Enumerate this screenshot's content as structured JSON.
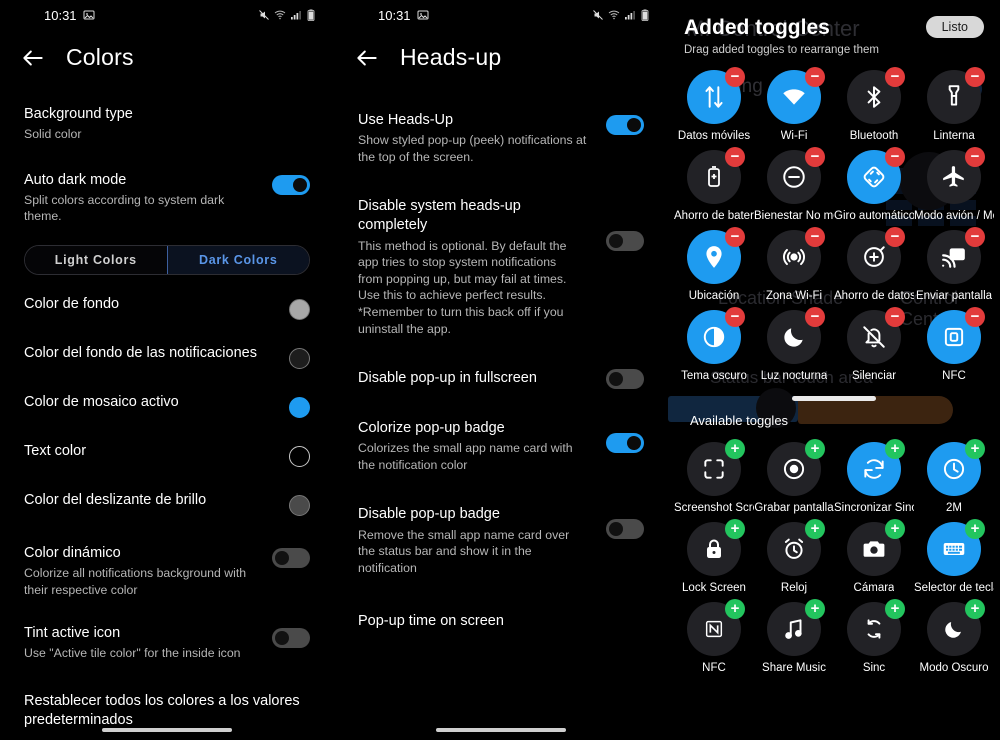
{
  "status_bar": {
    "time": "10:31",
    "left_icons": [
      "image-icon"
    ],
    "right_icons": [
      "mute-icon",
      "wifi-icon",
      "signal-icon",
      "battery-icon"
    ]
  },
  "panel_colors": {
    "title": "Colors",
    "back_icon": "back-arrow-icon",
    "rows": [
      {
        "title": "Background type",
        "sub": "Solid color",
        "control": "none"
      },
      {
        "title": "Auto dark mode",
        "sub": "Split colors according to system dark theme.",
        "control": "toggle",
        "state": "on"
      }
    ],
    "segmented": {
      "options": [
        "Light Colors",
        "Dark Colors"
      ],
      "selected": "Dark Colors"
    },
    "color_rows": [
      {
        "title": "Color de fondo",
        "swatch": "#a8a8a8"
      },
      {
        "title": "Color del fondo de las notificaciones",
        "swatch": "#1d1d1d"
      },
      {
        "title": "Color de mosaico activo",
        "swatch": "#1e9bf0"
      },
      {
        "title": "Text color",
        "swatch": "#000000"
      },
      {
        "title": "Color del deslizante de brillo",
        "swatch": "#4a4a4a"
      }
    ],
    "bottom_rows": [
      {
        "title": "Color dinámico",
        "sub": "Colorize all notifications background with their respective color",
        "control": "toggle",
        "state": "off"
      },
      {
        "title": "Tint active icon",
        "sub": "Use \"Active tile color\" for the inside icon",
        "control": "toggle",
        "state": "off"
      }
    ],
    "reset_label": "Restablecer todos los colores a los valores predeterminados"
  },
  "panel_headsup": {
    "title": "Heads-up",
    "back_icon": "back-arrow-icon",
    "rows": [
      {
        "title": "Use Heads-Up",
        "sub": "Show styled pop-up (peek) notifications at the top of the screen.",
        "control": "toggle",
        "state": "on"
      },
      {
        "title": "Disable system heads-up completely",
        "sub": "This method is optional. By default the app tries to stop system notifications from popping up, but may fail at times. Use this to achieve perfect results. *Remember to turn this back off if you uninstall the app.",
        "control": "toggle",
        "state": "off"
      },
      {
        "title": "Disable pop-up in fullscreen",
        "sub": "",
        "control": "toggle",
        "state": "off"
      },
      {
        "title": "Colorize pop-up badge",
        "sub": "Colorizes the small app name card with the notification color",
        "control": "toggle",
        "state": "on"
      },
      {
        "title": "Disable pop-up badge",
        "sub": "Remove the small app name card over the status bar and show it in the notification",
        "control": "toggle",
        "state": "off"
      },
      {
        "title": "Pop-up time on screen",
        "sub": "",
        "control": "none"
      }
    ]
  },
  "panel_toggles": {
    "background_ghost": {
      "app_title": "MI Control Center",
      "running_label": "Running",
      "location_shade": "Location Shade",
      "control_center": "Control Center",
      "status_bar_touch": "Status bar touch area"
    },
    "title": "Added toggles",
    "subtitle": "Drag added toggles to rearrange them",
    "done_label": "Listo",
    "available_label": "Available toggles",
    "added": [
      {
        "label": "Datos móviles",
        "icon": "data-transfer-icon",
        "active": true,
        "badge": "minus"
      },
      {
        "label": "Wi-Fi",
        "icon": "wifi-icon",
        "active": true,
        "badge": "minus"
      },
      {
        "label": "Bluetooth",
        "icon": "bluetooth-icon",
        "active": false,
        "badge": "minus"
      },
      {
        "label": "Linterna",
        "icon": "flashlight-icon",
        "active": false,
        "badge": "minus"
      },
      {
        "label": "Ahorro de batería",
        "icon": "battery-saver-icon",
        "active": false,
        "badge": "minus"
      },
      {
        "label": "Bienestar No molestar",
        "icon": "do-not-disturb-icon",
        "active": false,
        "badge": "minus"
      },
      {
        "label": "Giro automático / Girar",
        "icon": "auto-rotate-icon",
        "active": true,
        "badge": "minus"
      },
      {
        "label": "Modo avión / Modo",
        "icon": "airplane-icon",
        "active": false,
        "badge": "minus"
      },
      {
        "label": "Ubicación",
        "icon": "location-pin-icon",
        "active": true,
        "badge": "minus"
      },
      {
        "label": "Zona Wi-Fi",
        "icon": "hotspot-icon",
        "active": false,
        "badge": "minus"
      },
      {
        "label": "Ahorro de datos",
        "icon": "data-saver-icon",
        "active": false,
        "badge": "minus"
      },
      {
        "label": "Enviar pantalla",
        "icon": "cast-icon",
        "active": false,
        "badge": "minus"
      },
      {
        "label": "Tema oscuro",
        "icon": "contrast-icon",
        "active": true,
        "badge": "minus"
      },
      {
        "label": "Luz nocturna",
        "icon": "moon-icon",
        "active": false,
        "badge": "minus"
      },
      {
        "label": "Silenciar",
        "icon": "bell-off-icon",
        "active": false,
        "badge": "minus"
      },
      {
        "label": "NFC",
        "icon": "nfc-square-icon",
        "active": true,
        "badge": "minus"
      }
    ],
    "available": [
      {
        "label": "Screenshot Screen",
        "icon": "screenshot-icon",
        "active": false,
        "badge": "plus"
      },
      {
        "label": "Grabar pantalla",
        "icon": "record-icon",
        "active": false,
        "badge": "plus"
      },
      {
        "label": "Sincronizar Sinc",
        "icon": "sync-icon",
        "active": true,
        "badge": "plus"
      },
      {
        "label": "2M",
        "icon": "clock-icon",
        "active": true,
        "badge": "plus"
      },
      {
        "label": "Lock Screen",
        "icon": "lock-icon",
        "active": false,
        "badge": "plus"
      },
      {
        "label": "Reloj",
        "icon": "alarm-icon",
        "active": false,
        "badge": "plus"
      },
      {
        "label": "Cámara",
        "icon": "camera-icon",
        "active": false,
        "badge": "plus"
      },
      {
        "label": "Selector de teclado",
        "icon": "keyboard-icon",
        "active": true,
        "badge": "plus"
      },
      {
        "label": "NFC",
        "icon": "nfc-icon",
        "active": false,
        "badge": "plus"
      },
      {
        "label": "Share Music",
        "icon": "music-share-icon",
        "active": false,
        "badge": "plus"
      },
      {
        "label": "Sinc",
        "icon": "sync-alt-icon",
        "active": false,
        "badge": "plus"
      },
      {
        "label": "Modo Oscuro",
        "icon": "crescent-icon",
        "active": false,
        "badge": "plus"
      }
    ]
  }
}
